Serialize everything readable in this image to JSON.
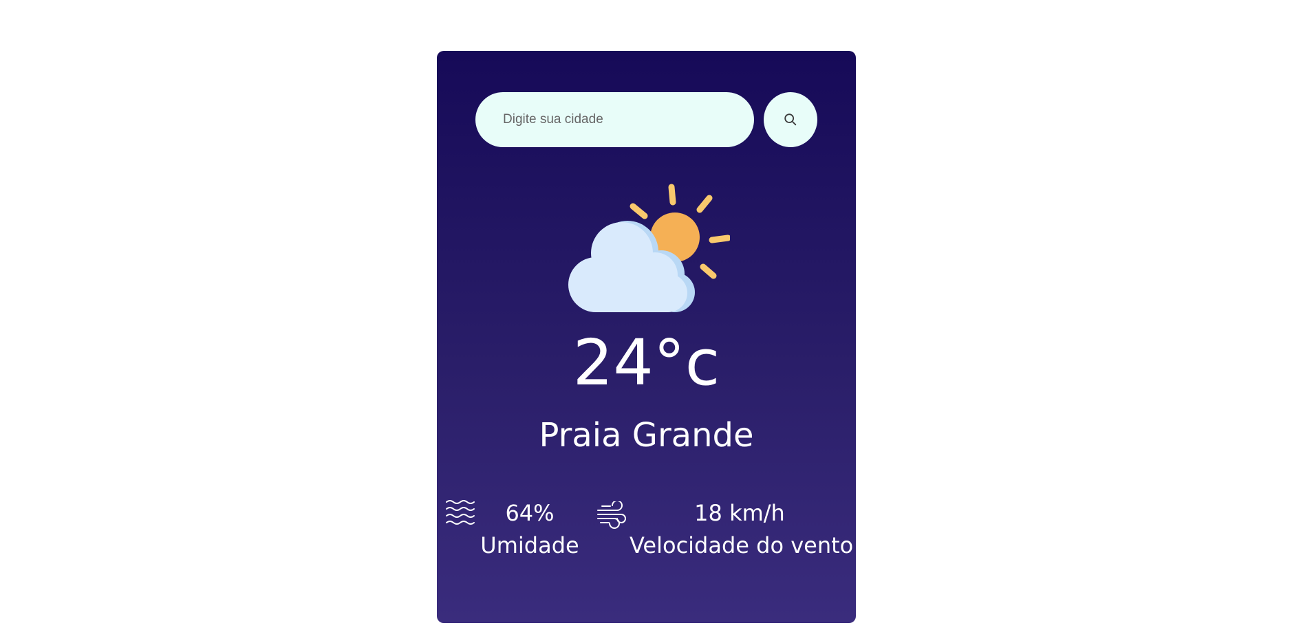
{
  "search": {
    "placeholder": "Digite sua cidade",
    "value": ""
  },
  "icons": {
    "search_button": "search-icon",
    "weather": "partly-cloudy-icon",
    "humidity": "waves-icon",
    "wind": "wind-icon"
  },
  "weather": {
    "temperature": "24°c",
    "city": "Praia Grande"
  },
  "stats": {
    "humidity": {
      "value": "64%",
      "label": "Umidade"
    },
    "wind": {
      "value": "18 km/h",
      "label": "Velocidade do vento"
    }
  },
  "colors": {
    "card_top": "#160a58",
    "card_bottom": "#3a2c7d",
    "input_bg": "#e8fdf9",
    "text": "#ffffff",
    "sun": "#f5b055",
    "sun_rays": "#f9c96d",
    "cloud": "#d9eafc"
  }
}
